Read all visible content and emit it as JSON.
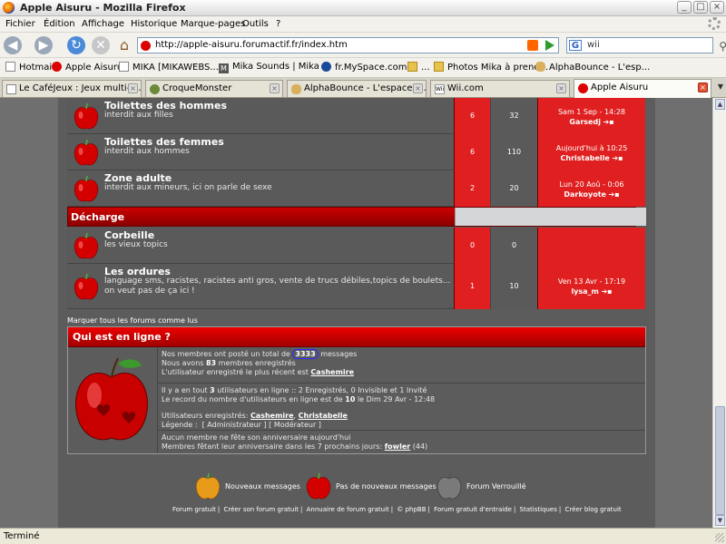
{
  "window": {
    "title": "Apple Aisuru - Mozilla Firefox"
  },
  "menu": [
    "Fichier",
    "Édition",
    "Affichage",
    "Historique",
    "Marque-pages",
    "Outils",
    "?"
  ],
  "nav": {
    "url": "http://apple-aisuru.forumactif.fr/index.htm",
    "search_value": "wii"
  },
  "bookmarks": [
    "Hotmail",
    "Apple Aisuru",
    "MIKA [MIKAWEBS...",
    "Mika Sounds | Mika ...",
    "fr.MySpace.com",
    "...",
    "Photos Mika à prend...",
    "AlphaBounce - L'esp..."
  ],
  "tabs": [
    {
      "label": "Le CaféJeux : Jeux multi-j..."
    },
    {
      "label": "CroqueMonster"
    },
    {
      "label": "AlphaBounce - L'espace in..."
    },
    {
      "label": "Wii.com"
    },
    {
      "label": "Apple Aisuru"
    }
  ],
  "forums": [
    {
      "name": "Toilettes des hommes",
      "desc": "interdit aux filles",
      "topics": "6",
      "posts": "32",
      "last_date": "Sam 1 Sep - 14:28",
      "last_user": "Garsedj"
    },
    {
      "name": "Toilettes des femmes",
      "desc": "interdit aux hommes",
      "topics": "6",
      "posts": "110",
      "last_date": "Aujourd'hui à 10:25",
      "last_user": "Christabelle"
    },
    {
      "name": "Zone adulte",
      "desc": "interdit aux mineurs, ici on parle de sexe",
      "topics": "2",
      "posts": "20",
      "last_date": "Lun 20 Aoû - 0:06",
      "last_user": "Darkoyote"
    }
  ],
  "section2": {
    "title": "Décharge"
  },
  "forums2": [
    {
      "name": "Corbeille",
      "desc": "les vieux topics",
      "topics": "0",
      "posts": "0",
      "last_date": "",
      "last_user": ""
    },
    {
      "name": "Les ordures",
      "desc": "language sms, racistes, racistes anti gros, vente de trucs débiles,topics de boulets...",
      "desc2": "on veut pas de ça ici !",
      "topics": "1",
      "posts": "10",
      "last_date": "Ven 13 Avr - 17:19",
      "last_user": "lysa_m"
    }
  ],
  "mark_all": "Marquer tous les forums comme lus",
  "online": {
    "title": "Qui est en ligne ?",
    "line1_pre": "Nos membres ont posté un total de",
    "posts_total": "3333",
    "line1_post": "messages",
    "line2_pre": "Nous avons",
    "members": "83",
    "line2_post": "membres enregistrés",
    "line3_pre": "L'utilisateur enregistré le plus récent est",
    "newest": "Cashemire",
    "line4_pre": "Il y a en tout",
    "users_total": "3",
    "line4_post": "utilisateurs en ligne :: 2 Enregistrés, 0 Invisible et 1 Invité",
    "line5_pre": "Le record du nombre d'utilisateurs en ligne est de",
    "record": "10",
    "line5_post": "le Dim 29 Avr - 12:48",
    "registered_label": "Utilisateurs enregistrés:",
    "reg_user1": "Cashemire",
    "reg_user2": "Christabelle",
    "legend_label": "Légende :",
    "legend_admin": "[ Administrateur ]",
    "legend_mod": "[ Modérateur ]",
    "bday1": "Aucun membre ne fête son anniversaire aujourd'hui",
    "bday2_pre": "Membres fêtant leur anniversaire dans les 7 prochains jours:",
    "bday_user": "fowler",
    "bday_age": "(44)"
  },
  "legend": {
    "new": "Nouveaux messages",
    "none": "Pas de nouveaux messages",
    "locked": "Forum Verrouillé"
  },
  "footer": [
    "Forum gratuit",
    "Créer son forum gratuit",
    "Annuaire de forum gratuit",
    "© phpBB",
    "Forum gratuit d'entraide",
    "Statistiques",
    "Créer blog gratuit"
  ],
  "status": "Terminé",
  "colors": {
    "accent_red": "#e02020",
    "header_red": "#cc0000",
    "bg": "#6f6f6f"
  }
}
